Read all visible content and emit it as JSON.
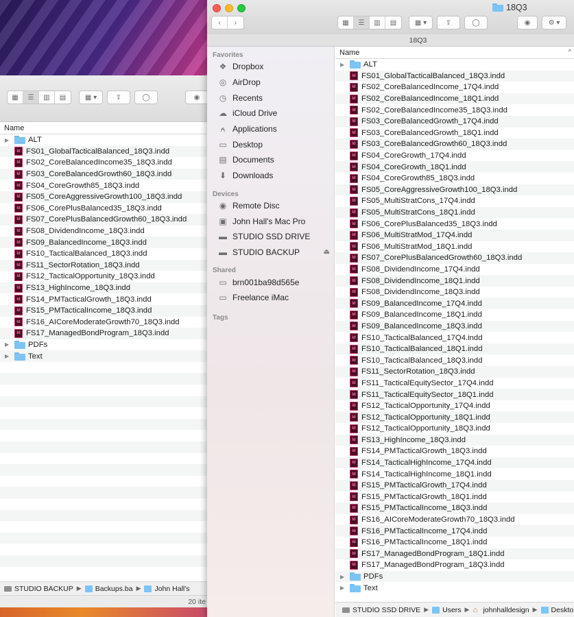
{
  "back_window": {
    "column_header": "Name",
    "rows": [
      {
        "type": "folder",
        "name": "ALT"
      },
      {
        "type": "indd",
        "name": "FS01_GlobalTacticalBalanced_18Q3.indd"
      },
      {
        "type": "indd",
        "name": "FS02_CoreBalancedIncome35_18Q3.indd"
      },
      {
        "type": "indd",
        "name": "FS03_CoreBalancedGrowth60_18Q3.indd"
      },
      {
        "type": "indd",
        "name": "FS04_CoreGrowth85_18Q3.indd"
      },
      {
        "type": "indd",
        "name": "FS05_CoreAggressiveGrowth100_18Q3.indd"
      },
      {
        "type": "indd",
        "name": "FS06_CorePlusBalanced35_18Q3.indd"
      },
      {
        "type": "indd",
        "name": "FS07_CorePlusBalancedGrowth60_18Q3.indd"
      },
      {
        "type": "indd",
        "name": "FS08_DividendIncome_18Q3.indd"
      },
      {
        "type": "indd",
        "name": "FS09_BalancedIncome_18Q3.indd"
      },
      {
        "type": "indd",
        "name": "FS10_TacticalBalanced_18Q3.indd"
      },
      {
        "type": "indd",
        "name": "FS11_SectorRotation_18Q3.indd"
      },
      {
        "type": "indd",
        "name": "FS12_TacticalOpportunity_18Q3.indd"
      },
      {
        "type": "indd",
        "name": "FS13_HighIncome_18Q3.indd"
      },
      {
        "type": "indd",
        "name": "FS14_PMTacticalGrowth_18Q3.indd"
      },
      {
        "type": "indd",
        "name": "FS15_PMTacticalIncome_18Q3.indd"
      },
      {
        "type": "indd",
        "name": "FS16_AICoreModerateGrowth70_18Q3.indd"
      },
      {
        "type": "indd",
        "name": "FS17_ManagedBondProgram_18Q3.indd"
      },
      {
        "type": "folder",
        "name": "PDFs"
      },
      {
        "type": "folder",
        "name": "Text"
      }
    ],
    "pathbar": [
      "STUDIO BACKUP",
      "Backups.ba",
      "John Hall's"
    ],
    "status": "20 ite"
  },
  "front_window": {
    "title": "18Q3",
    "subtitle": "18Q3",
    "column_header": "Name",
    "sidebar": {
      "favorites_heading": "Favorites",
      "favorites": [
        {
          "icon": "dropbox-icon",
          "label": "Dropbox"
        },
        {
          "icon": "airdrop-icon",
          "label": "AirDrop"
        },
        {
          "icon": "recents-icon",
          "label": "Recents"
        },
        {
          "icon": "icloud-icon",
          "label": "iCloud Drive"
        },
        {
          "icon": "applications-icon",
          "label": "Applications"
        },
        {
          "icon": "desktop-icon",
          "label": "Desktop"
        },
        {
          "icon": "documents-icon",
          "label": "Documents"
        },
        {
          "icon": "downloads-icon",
          "label": "Downloads"
        }
      ],
      "devices_heading": "Devices",
      "devices": [
        {
          "icon": "disc-icon",
          "label": "Remote Disc"
        },
        {
          "icon": "computer-icon",
          "label": "John Hall's Mac Pro"
        },
        {
          "icon": "drive-icon",
          "label": "STUDIO SSD DRIVE"
        },
        {
          "icon": "drive-icon",
          "label": "STUDIO BACKUP",
          "eject": "⏏"
        }
      ],
      "shared_heading": "Shared",
      "shared": [
        {
          "icon": "network-computer-icon",
          "label": "brn001ba98d565e"
        },
        {
          "icon": "imac-icon",
          "label": "Freelance iMac"
        }
      ],
      "tags_heading": "Tags"
    },
    "rows": [
      {
        "type": "folder",
        "name": "ALT"
      },
      {
        "type": "indd",
        "name": "FS01_GlobalTacticalBalanced_18Q3.indd"
      },
      {
        "type": "indd",
        "name": "FS02_CoreBalancedIncome_17Q4.indd"
      },
      {
        "type": "indd",
        "name": "FS02_CoreBalancedIncome_18Q1.indd"
      },
      {
        "type": "indd",
        "name": "FS02_CoreBalancedIncome35_18Q3.indd"
      },
      {
        "type": "indd",
        "name": "FS03_CoreBalancedGrowth_17Q4.indd"
      },
      {
        "type": "indd",
        "name": "FS03_CoreBalancedGrowth_18Q1.indd"
      },
      {
        "type": "indd",
        "name": "FS03_CoreBalancedGrowth60_18Q3.indd"
      },
      {
        "type": "indd",
        "name": "FS04_CoreGrowth_17Q4.indd"
      },
      {
        "type": "indd",
        "name": "FS04_CoreGrowth_18Q1.indd"
      },
      {
        "type": "indd",
        "name": "FS04_CoreGrowth85_18Q3.indd"
      },
      {
        "type": "indd",
        "name": "FS05_CoreAggressiveGrowth100_18Q3.indd"
      },
      {
        "type": "indd",
        "name": "FS05_MultiStratCons_17Q4.indd"
      },
      {
        "type": "indd",
        "name": "FS05_MultiStratCons_18Q1.indd"
      },
      {
        "type": "indd",
        "name": "FS06_CorePlusBalanced35_18Q3.indd"
      },
      {
        "type": "indd",
        "name": "FS06_MultiStratMod_17Q4.indd"
      },
      {
        "type": "indd",
        "name": "FS06_MultiStratMod_18Q1.indd"
      },
      {
        "type": "indd",
        "name": "FS07_CorePlusBalancedGrowth60_18Q3.indd"
      },
      {
        "type": "indd",
        "name": "FS08_DividendIncome_17Q4.indd"
      },
      {
        "type": "indd",
        "name": "FS08_DividendIncome_18Q1.indd"
      },
      {
        "type": "indd",
        "name": "FS08_DividendIncome_18Q3.indd"
      },
      {
        "type": "indd",
        "name": "FS09_BalancedIncome_17Q4.indd"
      },
      {
        "type": "indd",
        "name": "FS09_BalancedIncome_18Q1.indd"
      },
      {
        "type": "indd",
        "name": "FS09_BalancedIncome_18Q3.indd"
      },
      {
        "type": "indd",
        "name": "FS10_TacticalBalanced_17Q4.indd"
      },
      {
        "type": "indd",
        "name": "FS10_TacticalBalanced_18Q1.indd"
      },
      {
        "type": "indd",
        "name": "FS10_TacticalBalanced_18Q3.indd"
      },
      {
        "type": "indd",
        "name": "FS11_SectorRotation_18Q3.indd"
      },
      {
        "type": "indd",
        "name": "FS11_TacticalEquitySector_17Q4.indd"
      },
      {
        "type": "indd",
        "name": "FS11_TacticalEquitySector_18Q1.indd"
      },
      {
        "type": "indd",
        "name": "FS12_TacticalOpportunity_17Q4.indd"
      },
      {
        "type": "indd",
        "name": "FS12_TacticalOpportunity_18Q1.indd"
      },
      {
        "type": "indd",
        "name": "FS12_TacticalOpportunity_18Q3.indd"
      },
      {
        "type": "indd",
        "name": "FS13_HighIncome_18Q3.indd"
      },
      {
        "type": "indd",
        "name": "FS14_PMTacticalGrowth_18Q3.indd"
      },
      {
        "type": "indd",
        "name": "FS14_TacticalHighIncome_17Q4.indd"
      },
      {
        "type": "indd",
        "name": "FS14_TacticalHighIncome_18Q1.indd"
      },
      {
        "type": "indd",
        "name": "FS15_PMTacticalGrowth_17Q4.indd"
      },
      {
        "type": "indd",
        "name": "FS15_PMTacticalGrowth_18Q1.indd"
      },
      {
        "type": "indd",
        "name": "FS15_PMTacticalIncome_18Q3.indd"
      },
      {
        "type": "indd",
        "name": "FS16_AICoreModerateGrowth70_18Q3.indd"
      },
      {
        "type": "indd",
        "name": "FS16_PMTacticalIncome_17Q4.indd"
      },
      {
        "type": "indd",
        "name": "FS16_PMTacticalIncome_18Q1.indd"
      },
      {
        "type": "indd",
        "name": "FS17_ManagedBondProgram_18Q1.indd"
      },
      {
        "type": "indd",
        "name": "FS17_ManagedBondProgram_18Q3.indd"
      },
      {
        "type": "folder",
        "name": "PDFs"
      },
      {
        "type": "folder",
        "name": "Text"
      }
    ],
    "pathbar": [
      {
        "icon": "drive-icon",
        "label": "STUDIO SSD DRIVE"
      },
      {
        "icon": "folder-icon",
        "label": "Users"
      },
      {
        "icon": "home-icon",
        "label": "johnhalldesign"
      },
      {
        "icon": "folder-icon",
        "label": "Desktop"
      }
    ]
  },
  "icons": {
    "indd_label": "Id",
    "disclosure": "▶",
    "sort": "^"
  },
  "colors": {
    "folder": "#7cc4f5",
    "indd_bg": "#4a0d24",
    "indd_fg": "#ff6fa6",
    "close": "#fc5f57",
    "minimize": "#fdbc2e",
    "maximize": "#28c840"
  }
}
